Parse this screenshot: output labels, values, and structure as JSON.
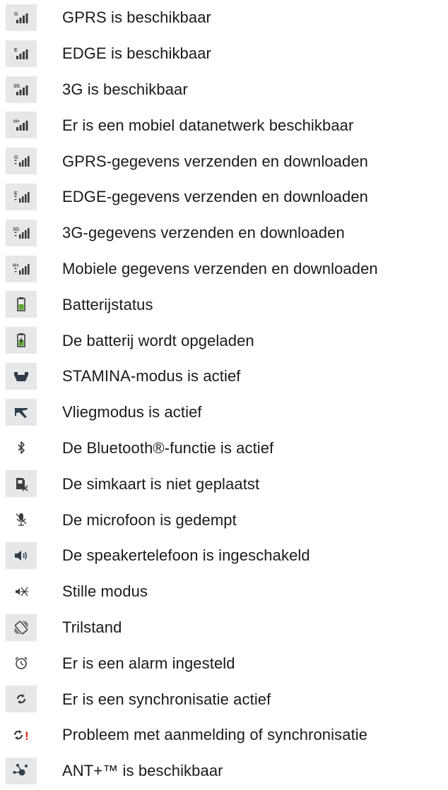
{
  "rows": [
    {
      "icon": "signal-g-icon",
      "label": "GPRS is beschikbaar"
    },
    {
      "icon": "signal-e-icon",
      "label": "EDGE is beschikbaar"
    },
    {
      "icon": "signal-3g-icon",
      "label": "3G is beschikbaar"
    },
    {
      "icon": "signal-h-plus-icon",
      "label": "Er is een mobiel datanetwerk beschikbaar"
    },
    {
      "icon": "signal-g-transfer-icon",
      "label": "GPRS-gegevens verzenden en downloaden"
    },
    {
      "icon": "signal-e-transfer-icon",
      "label": "EDGE-gegevens verzenden en downloaden"
    },
    {
      "icon": "signal-3g-transfer-icon",
      "label": "3G-gegevens verzenden en downloaden"
    },
    {
      "icon": "signal-h-plus-transfer-icon",
      "label": "Mobiele gegevens verzenden en downloaden"
    },
    {
      "icon": "battery-icon",
      "label": "Batterijstatus"
    },
    {
      "icon": "battery-charging-icon",
      "label": "De batterij wordt opgeladen"
    },
    {
      "icon": "stamina-icon",
      "label": "STAMINA-modus is actief"
    },
    {
      "icon": "airplane-icon",
      "label": "Vliegmodus is actief"
    },
    {
      "icon": "bluetooth-icon",
      "label": "De Bluetooth®-functie is actief"
    },
    {
      "icon": "no-sim-icon",
      "label": "De simkaart is niet geplaatst"
    },
    {
      "icon": "mic-muted-icon",
      "label": "De microfoon is gedempt"
    },
    {
      "icon": "speaker-icon",
      "label": "De speakertelefoon is ingeschakeld"
    },
    {
      "icon": "silent-mode-icon",
      "label": "Stille modus"
    },
    {
      "icon": "vibrate-icon",
      "label": "Trilstand"
    },
    {
      "icon": "alarm-icon",
      "label": "Er is een alarm ingesteld"
    },
    {
      "icon": "sync-icon",
      "label": "Er is een synchronisatie actief"
    },
    {
      "icon": "sync-problem-icon",
      "label": "Probleem met aanmelding of synchronisatie"
    },
    {
      "icon": "ant-plus-icon",
      "label": "ANT+™ is beschikbaar"
    }
  ],
  "icon_text": {
    "g": "G",
    "e": "E",
    "g3": "3G",
    "hplus": "H+",
    "excl": "!"
  },
  "colors": {
    "icon_bg": "#e6e7e8",
    "icon_fg": "#3c3c3c",
    "battery_green": "#5aa82a",
    "alert_red": "#e0201b"
  }
}
